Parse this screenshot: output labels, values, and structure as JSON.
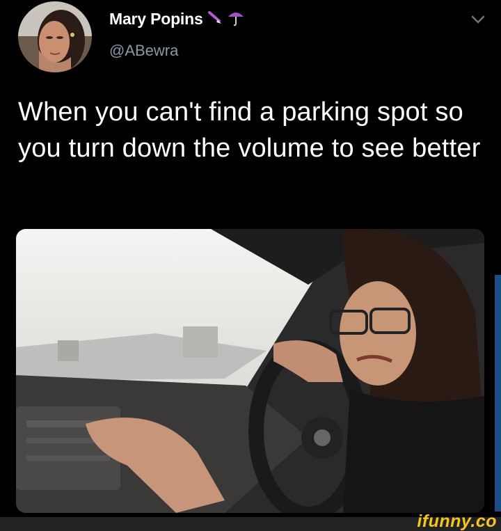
{
  "tweet": {
    "display_name": "Mary Popins",
    "display_name_emoji": [
      "pen-icon",
      "umbrella-icon"
    ],
    "handle": "@ABewra",
    "text": "When you can't find a parking spot so you turn down the volume to see better"
  },
  "media": {
    "description_icon": "photo"
  },
  "watermark": {
    "text": "ifunny.co"
  },
  "colors": {
    "background": "#000000",
    "handle": "#8b98a5",
    "watermark": "#f6c422"
  }
}
